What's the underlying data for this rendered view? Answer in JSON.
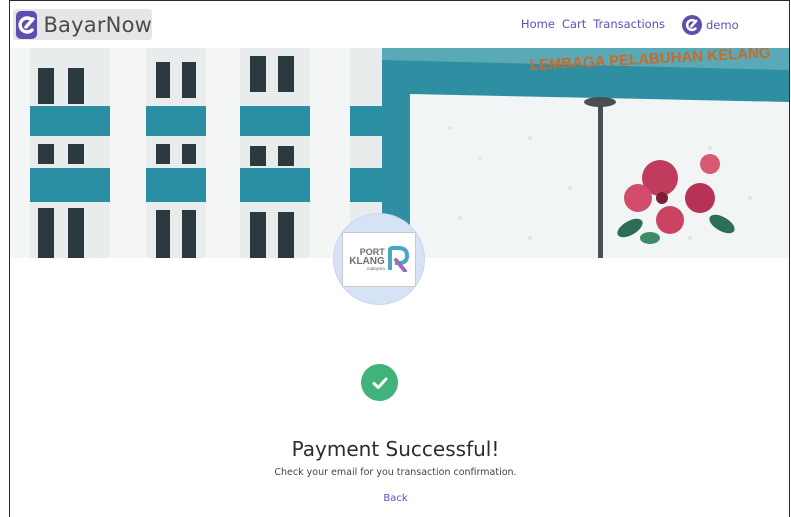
{
  "brand": {
    "name": "BayarNow"
  },
  "nav": {
    "links": [
      "Home",
      "Cart",
      "Transactions"
    ],
    "user": "demo"
  },
  "banner": {
    "sign_text": "LEMBAGA PELABUHAN KELANG"
  },
  "logo": {
    "line1": "PORT",
    "line2": "KLANG",
    "line3": "malaysia"
  },
  "result": {
    "title": "Payment Successful!",
    "message": "Check your email for you transaction confirmation.",
    "back_label": "Back"
  },
  "colors": {
    "accent": "#5a4fc0",
    "success": "#41b37a",
    "banner": "#2f8fa2"
  }
}
